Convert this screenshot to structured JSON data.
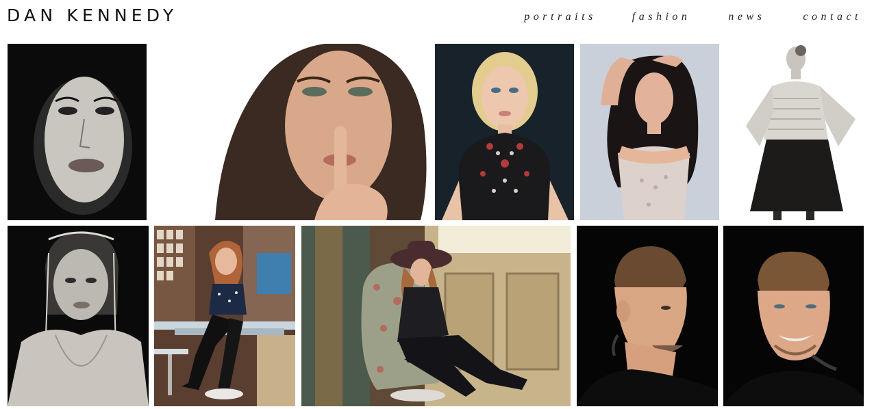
{
  "site": {
    "title": "DAN KENNEDY"
  },
  "nav": [
    {
      "label": "portraits"
    },
    {
      "label": "fashion"
    },
    {
      "label": "news"
    },
    {
      "label": "contact"
    }
  ],
  "gallery": {
    "row1": [
      "photo-bw-woman-portrait",
      "photo-woman-finger-to-lips",
      "photo-blonde-woman-jeweled-dress",
      "photo-woman-lace-dress-arm-raised",
      "photo-bw-woman-sweater-skirt"
    ],
    "row2": [
      "photo-bw-woman-headpiece",
      "photo-woman-seated-collage-wall",
      "photo-woman-hat-armchair",
      "photo-man-tattoo-profile",
      "photo-man-smiling-tattoo"
    ]
  }
}
